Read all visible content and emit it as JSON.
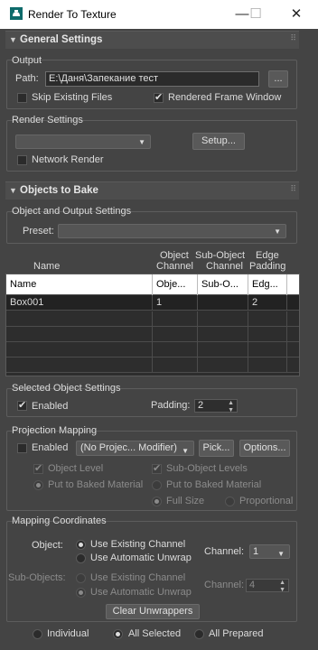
{
  "window": {
    "title": "Render To Texture",
    "minimize": "—",
    "maximize": "☐",
    "close": "✕"
  },
  "general": {
    "header": "General Settings",
    "output": {
      "group_label": "Output",
      "path_label": "Path:",
      "path_value": "E:\\Даня\\Запекание тест",
      "browse": "...",
      "skip_existing": "Skip Existing Files",
      "rendered_frame_window": "Rendered Frame Window"
    },
    "render_settings": {
      "group_label": "Render Settings",
      "preset_value": "",
      "setup": "Setup...",
      "network_render": "Network Render"
    }
  },
  "objects": {
    "header": "Objects to Bake",
    "group_label": "Object and Output Settings",
    "preset_label": "Preset:",
    "preset_value": "",
    "columns": {
      "name": "Name",
      "object_channel_1": "Object",
      "object_channel_2": "Channel",
      "subobj_channel_1": "Sub-Object",
      "subobj_channel_2": "Channel",
      "edge_padding_1": "Edge",
      "edge_padding_2": "Padding"
    },
    "table": {
      "header": [
        "Name",
        "Obje...",
        "Sub-O...",
        "Edg..."
      ],
      "rows": [
        [
          "Box001",
          "1",
          "",
          "2"
        ]
      ]
    }
  },
  "selected": {
    "group_label": "Selected Object Settings",
    "enabled": "Enabled",
    "padding_label": "Padding:",
    "padding_value": "2"
  },
  "projection": {
    "group_label": "Projection Mapping",
    "enabled": "Enabled",
    "modifier": "(No Projec... Modifier)",
    "pick": "Pick...",
    "options": "Options...",
    "object_level": "Object Level",
    "sub_object_levels": "Sub-Object Levels",
    "put_baked_1": "Put to Baked Material",
    "put_baked_2": "Put to Baked Material",
    "full_size": "Full Size",
    "proportional": "Proportional"
  },
  "mapping": {
    "group_label": "Mapping Coordinates",
    "object_label": "Object:",
    "use_existing": "Use Existing Channel",
    "use_auto": "Use Automatic Unwrap",
    "channel_label": "Channel:",
    "channel_value": "1",
    "sub_objects_label": "Sub-Objects:",
    "sub_use_existing": "Use Existing Channel",
    "sub_use_auto": "Use Automatic Unwrap",
    "sub_channel_label": "Channel:",
    "sub_channel_value": "4",
    "clear": "Clear Unwrappers"
  },
  "bottom": {
    "individual": "Individual",
    "all_selected": "All Selected",
    "all_prepared": "All Prepared"
  }
}
